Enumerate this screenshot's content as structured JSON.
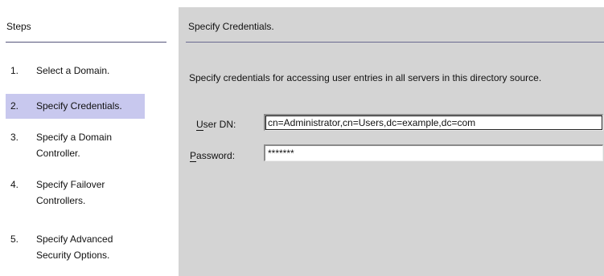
{
  "steps": {
    "title": "Steps",
    "items": [
      {
        "num": "1.",
        "line1": "Select a Domain.",
        "line2": ""
      },
      {
        "num": "2.",
        "line1": "Specify Credentials.",
        "line2": ""
      },
      {
        "num": "3.",
        "line1": "Specify a Domain",
        "line2": "Controller."
      },
      {
        "num": "4.",
        "line1": "Specify Failover",
        "line2": "Controllers."
      },
      {
        "num": "5.",
        "line1": "Specify Advanced",
        "line2": "Security Options."
      }
    ],
    "current_index": 1
  },
  "content": {
    "title": "Specify Credentials.",
    "description": "Specify credentials for accessing user entries in all servers in this directory source.",
    "user_dn": {
      "label_mnemonic": "U",
      "label_rest": "ser DN:",
      "value": "cn=Administrator,cn=Users,dc=example,dc=com"
    },
    "password": {
      "label_mnemonic": "P",
      "label_rest": "assword:",
      "value": "*******"
    }
  },
  "colors": {
    "selected_step": "#c8c8ee",
    "panel_bg": "#d4d4d4",
    "rule": "#6a6a90"
  }
}
